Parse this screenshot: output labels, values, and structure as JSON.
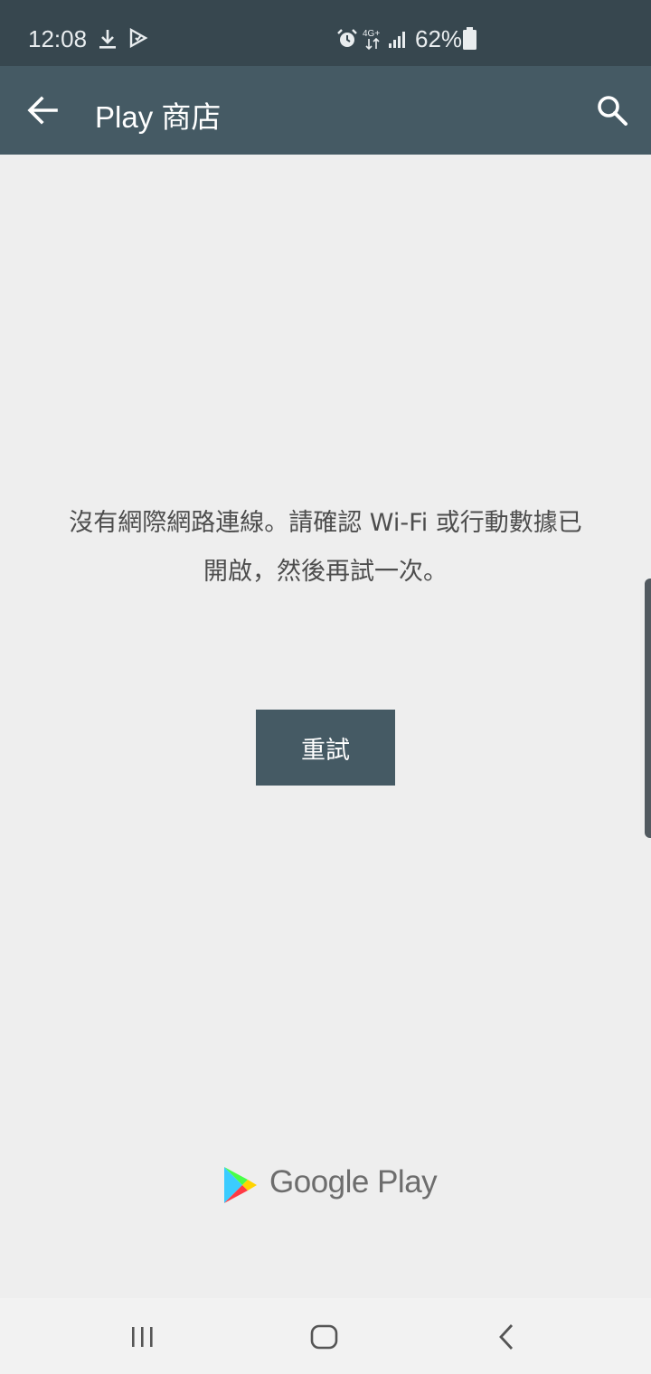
{
  "status_bar": {
    "time": "12:08",
    "network": "4G+",
    "battery_percent": "62%"
  },
  "app_bar": {
    "title": "Play 商店"
  },
  "message": {
    "line1": "沒有網際網路連線。請確認 Wi-Fi 或行動數據已",
    "line2": "開啟，然後再試一次。"
  },
  "retry_button": {
    "label": "重試"
  },
  "branding": {
    "logo_text": "Google Play"
  },
  "colors": {
    "status_bar": "#37474f",
    "app_bar": "#455a64",
    "background": "#eeeeee",
    "button": "#455a64"
  }
}
